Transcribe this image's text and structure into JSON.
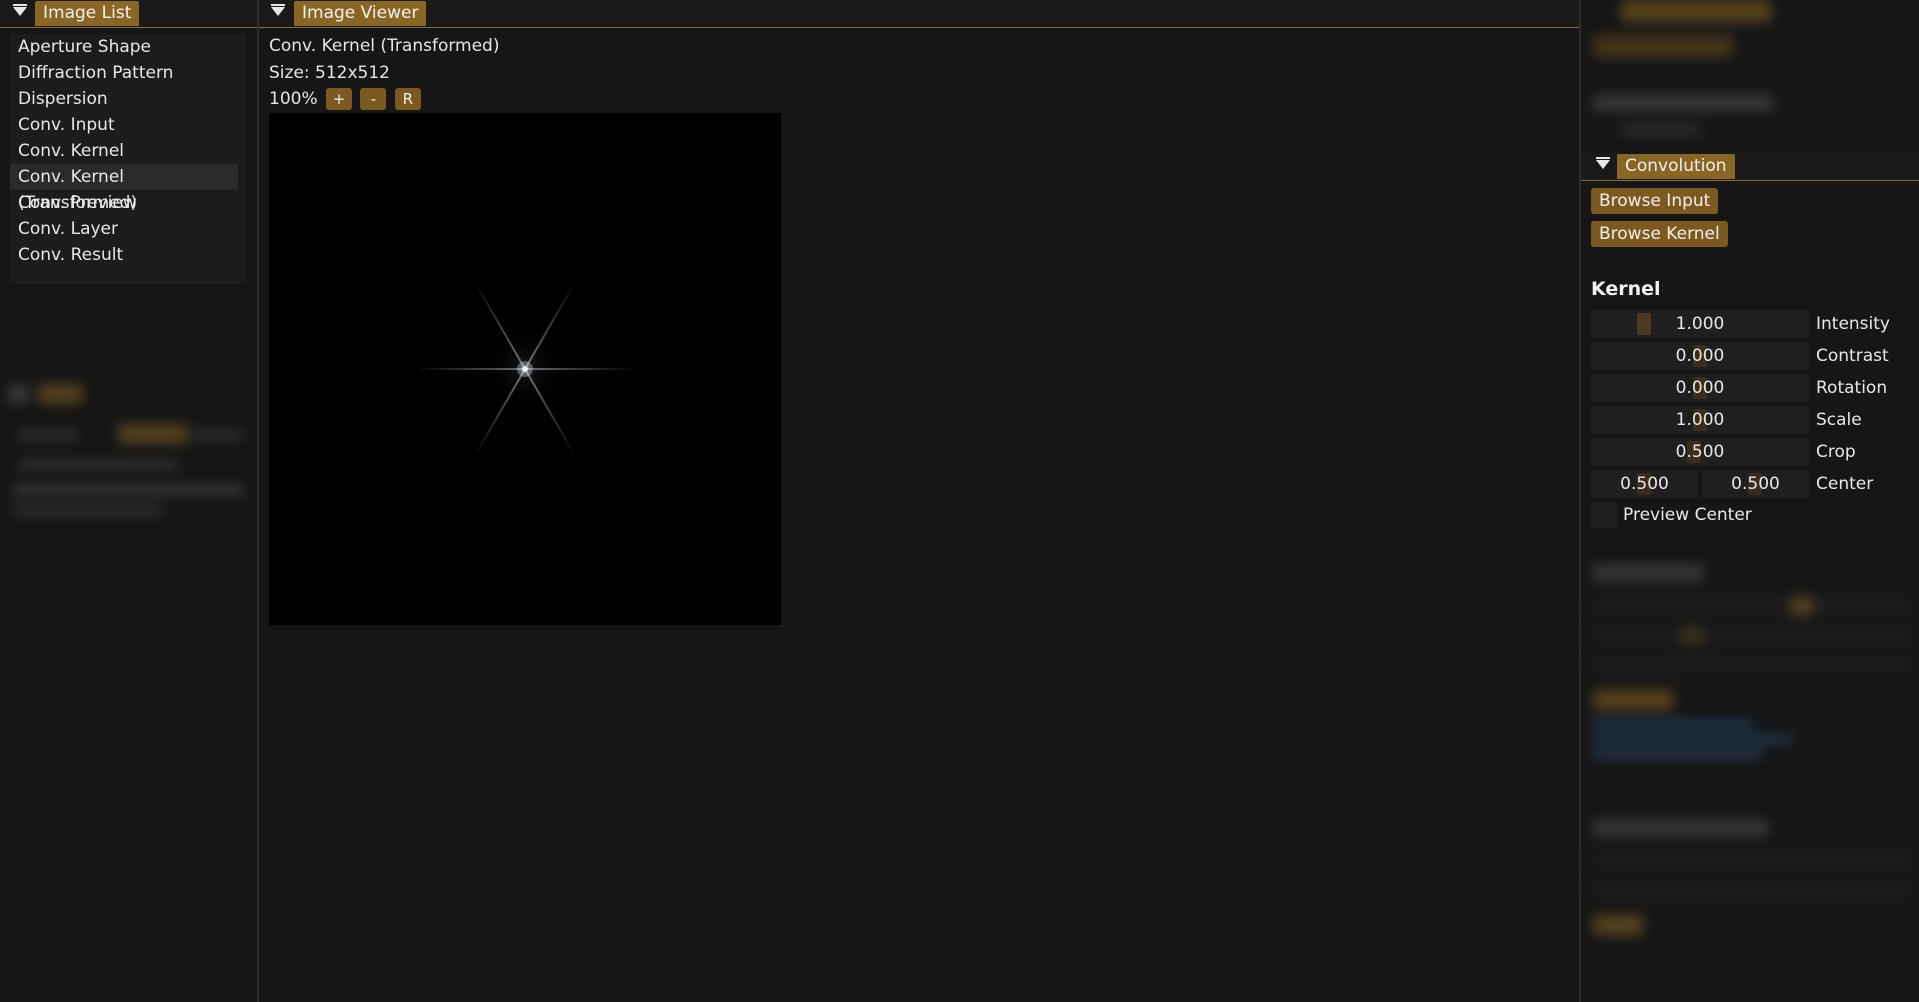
{
  "image_list": {
    "title": "Image List",
    "items": [
      "Aperture Shape",
      "Diffraction Pattern",
      "Dispersion",
      "Conv. Input",
      "Conv. Kernel",
      "Conv. Kernel (Transformed)",
      "Conv. Preview",
      "Conv. Layer",
      "Conv. Result"
    ],
    "selected_index": 5
  },
  "viewer": {
    "title": "Image Viewer",
    "image_name": "Conv. Kernel (Transformed)",
    "size_label": "Size: 512x512",
    "zoom": "100%",
    "zoom_in": "+",
    "zoom_out": "-",
    "reset": "R"
  },
  "convolution": {
    "title": "Convolution",
    "browse_input": "Browse Input",
    "browse_kernel": "Browse Kernel",
    "kernel_heading": "Kernel",
    "params": {
      "intensity": {
        "value": "1.000",
        "label": "Intensity"
      },
      "contrast": {
        "value": "0.000",
        "label": "Contrast"
      },
      "rotation": {
        "value": "0.000",
        "label": "Rotation"
      },
      "scale": {
        "value": "1.000",
        "label": "Scale"
      },
      "crop": {
        "value": "0.500",
        "label": "Crop"
      },
      "center_x": {
        "value": "0.500"
      },
      "center_y": {
        "value": "0.500"
      },
      "center_label": "Center"
    },
    "preview_center": "Preview Center"
  },
  "colors": {
    "accent": "#8a6624",
    "background": "#151515"
  }
}
